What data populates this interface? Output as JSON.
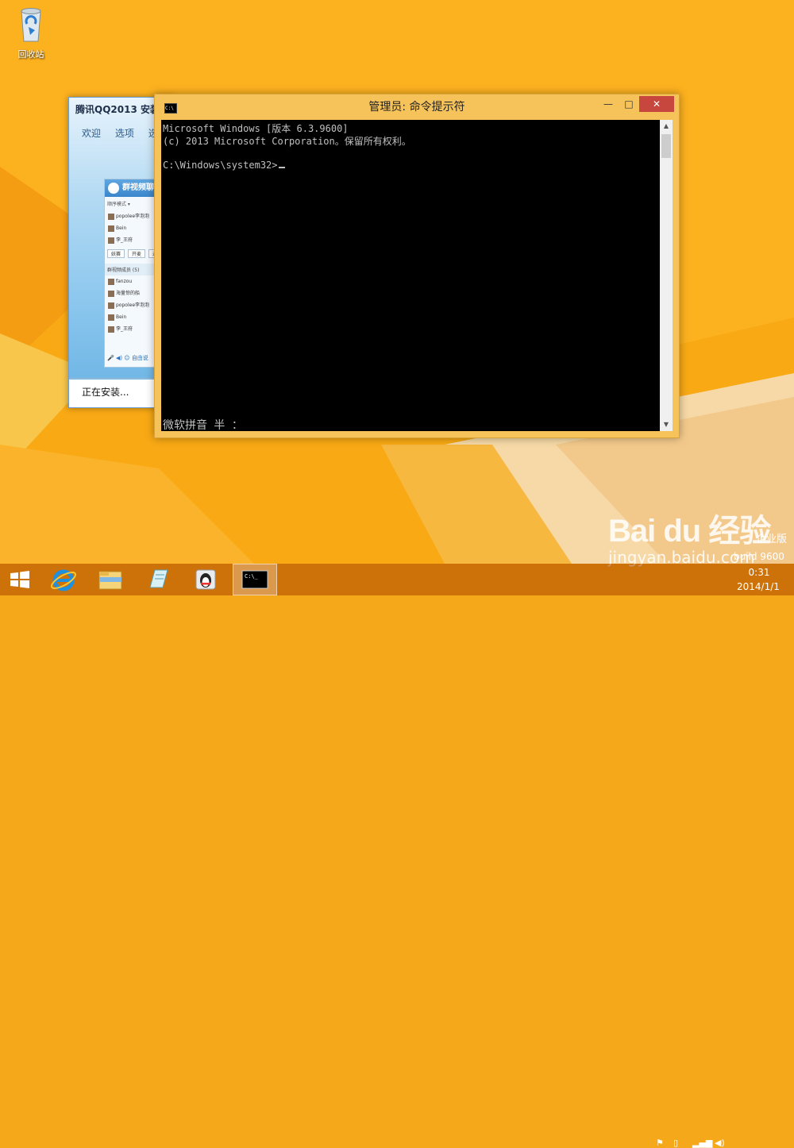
{
  "desktop": {
    "recycle_bin_label": "回收站",
    "watermark_brand": "Bai du 经验",
    "watermark_url": "jingyan.baidu.com",
    "edition": "企业版",
    "build": "build 9600"
  },
  "qq_installer": {
    "title": "腾讯QQ2013 安装",
    "tabs": [
      "欢迎",
      "选项",
      "选"
    ],
    "status": "正在安装...",
    "preview": {
      "header": "群视频聊",
      "sort": "顺序模式 ▾",
      "top_members": [
        "popolee李泡泡",
        "Bein",
        "李_王府"
      ],
      "buttons": [
        "妖赛",
        "开麦",
        "退"
      ],
      "section": "群视频成员 (5)",
      "members": [
        "fanzou",
        "海量惊的船",
        "popolee李泡泡",
        "Bein",
        "李_王府"
      ],
      "toolbar": "自由说"
    }
  },
  "cmd": {
    "title": "管理员: 命令提示符",
    "lines": [
      "Microsoft Windows [版本 6.3.9600]",
      "(c) 2013 Microsoft Corporation。保留所有权利。",
      "",
      "C:\\Windows\\system32>"
    ],
    "ime_status": "微软拼音 半 ：",
    "controls": {
      "minimize": "—",
      "maximize": "□",
      "close": "✕"
    }
  },
  "taskbar": {
    "items": [
      "start",
      "internet-explorer",
      "file-explorer",
      "notepad",
      "qq",
      "command-prompt"
    ],
    "active": "command-prompt",
    "clock_time": "0:31",
    "clock_date": "2014/1/1"
  }
}
